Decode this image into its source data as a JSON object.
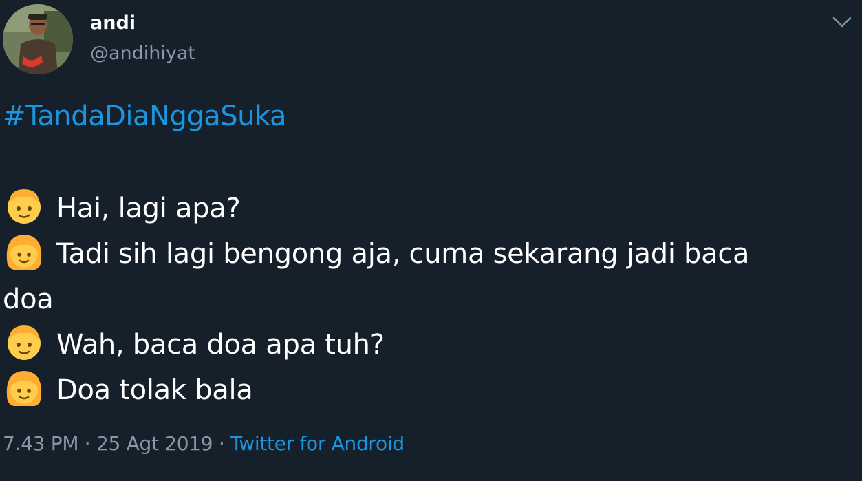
{
  "author": {
    "display_name": "andi",
    "handle": "@andihiyat"
  },
  "tweet": {
    "hashtag": "#TandaDiaNggaSuka",
    "lines": [
      {
        "emoji": "boy-face-icon",
        "text": "Hai, lagi apa?"
      },
      {
        "emoji": "girl-face-icon",
        "text": "Tadi sih lagi bengong aja, cuma sekarang jadi baca"
      },
      {
        "emoji": "",
        "text": "doa"
      },
      {
        "emoji": "boy-face-icon",
        "text": "Wah, baca doa apa tuh?"
      },
      {
        "emoji": "girl-face-icon",
        "text": "Doa tolak bala"
      }
    ]
  },
  "meta": {
    "time": "7.43 PM",
    "separator": " · ",
    "date": "25 Agt 2019",
    "source": "Twitter for Android"
  },
  "colors": {
    "background": "#15202b",
    "link": "#1b95e0",
    "secondary_text": "#8899a6",
    "primary_text": "#ffffff",
    "emoji_skin": "#ffcc4d",
    "emoji_hair": "#ffac33"
  }
}
